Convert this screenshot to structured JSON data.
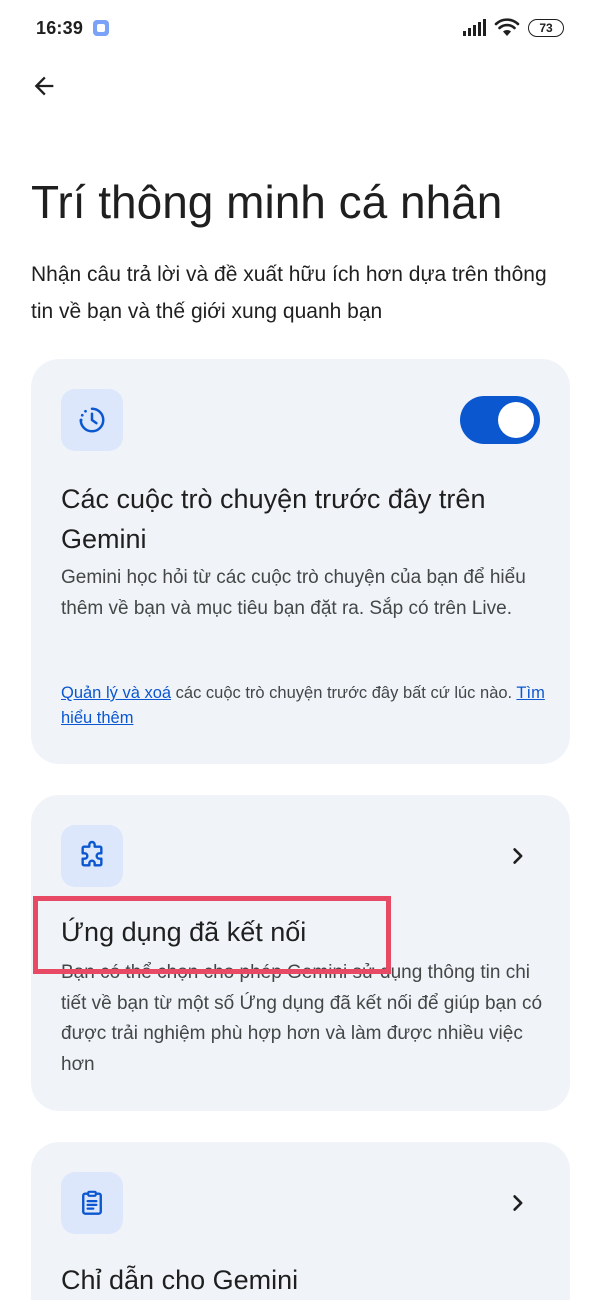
{
  "status_bar": {
    "time": "16:39",
    "battery": "73",
    "icons": [
      "notification-app-icon",
      "signal-icon",
      "wifi-icon",
      "battery-icon"
    ]
  },
  "header": {
    "back_icon": "arrow-back-icon",
    "title": "Trí thông minh cá nhân",
    "subtitle": "Nhận câu trả lời và đề xuất hữu ích hơn dựa trên thông tin về bạn và thế giới xung quanh bạn"
  },
  "cards": [
    {
      "icon": "history-clock-icon",
      "title": "Các cuộc trò chuyện trước đây trên Gemini",
      "description": "Gemini học hỏi từ các cuộc trò chuyện của bạn để hiểu thêm về bạn và mục tiêu bạn đặt ra. Sắp có trên Live.",
      "toggle_on": true,
      "note": {
        "link1": "Quản lý và xoá",
        "text": " các cuộc trò chuyện trước đây bất cứ lúc nào. ",
        "link2": "Tìm hiểu thêm"
      }
    },
    {
      "icon": "extension-puzzle-icon",
      "title": "Ứng dụng đã kết nối",
      "description": "Bạn có thể chọn cho phép Gemini sử dụng thông tin chi tiết về bạn từ một số Ứng dụng đã kết nối để giúp bạn có được trải nghiệm phù hợp hơn và làm được nhiều việc hơn"
    },
    {
      "icon": "clipboard-icon",
      "title": "Chỉ dẫn cho Gemini"
    }
  ],
  "colors": {
    "accent": "#0b57d0",
    "card_bg": "#f0f4f9",
    "icon_bg": "#dde7fb",
    "highlight": "#e84a66"
  }
}
